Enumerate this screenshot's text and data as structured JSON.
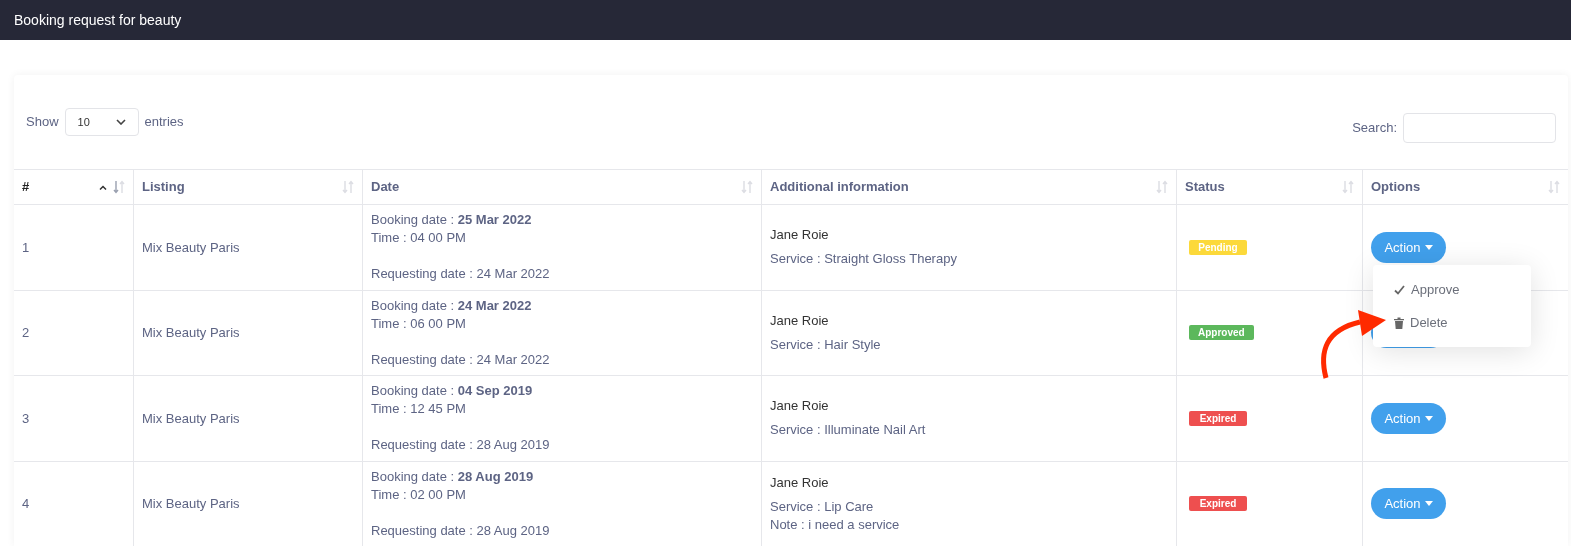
{
  "header": {
    "title": "Booking request for beauty"
  },
  "length_control": {
    "before": "Show",
    "value": "10",
    "after": "entries"
  },
  "search": {
    "label": "Search:"
  },
  "table": {
    "columns": [
      {
        "label": "#",
        "sorted": true
      },
      {
        "label": "Listing",
        "sorted": false
      },
      {
        "label": "Date",
        "sorted": false
      },
      {
        "label": "Additional information",
        "sorted": false
      },
      {
        "label": "Status",
        "sorted": false
      },
      {
        "label": "Options",
        "sorted": false
      }
    ],
    "rows": [
      {
        "number": "1",
        "listing": "Mix Beauty Paris",
        "booking": "Booking date : **25 Mar 2022**",
        "time": "Time : 04 00 PM",
        "requesting": "Requesting date : 24 Mar 2022",
        "name": "Jane Roie",
        "details": [
          "Service : Straight Gloss Therapy"
        ],
        "status": "Pending",
        "color": "#fcd93a",
        "action": "Action",
        "menu_open": true
      },
      {
        "number": "2",
        "listing": "Mix Beauty Paris",
        "booking": "Booking date : **24 Mar 2022**",
        "time": "Time : 06 00 PM",
        "requesting": "Requesting date : 24 Mar 2022",
        "name": "Jane Roie",
        "details": [
          "Service : Hair Style"
        ],
        "status": "Approved",
        "color": "#5cb85c",
        "menu_open": false
      },
      {
        "number": "3",
        "listing": "Mix Beauty Paris",
        "booking": "Booking date : **04 Sep 2019**",
        "time": "Time : 12 45 PM",
        "requesting": "Requesting date : 28 Aug 2019",
        "name": "Jane Roie",
        "details": [
          "Service : Illuminate Nail Art"
        ],
        "status": "Expired",
        "color": "#ee4f4f",
        "action": "Action",
        "menu_open": false
      },
      {
        "number": "4",
        "listing": "Mix Beauty Paris",
        "booking": "Booking date : **28 Aug 2019**",
        "time": "Time : 02 00 PM",
        "requesting": "Requesting date : 28 Aug 2019",
        "name": "Jane Roie",
        "details": [
          "Service : Lip Care",
          "Note : i need a service"
        ],
        "status": "Expired",
        "color": "#ee4f4f",
        "action": "Action",
        "menu_open": false
      }
    ]
  },
  "action_menu": {
    "items": [
      {
        "kind": "approve",
        "label": "Approve"
      },
      {
        "kind": "delete",
        "label": "Delete"
      }
    ]
  }
}
